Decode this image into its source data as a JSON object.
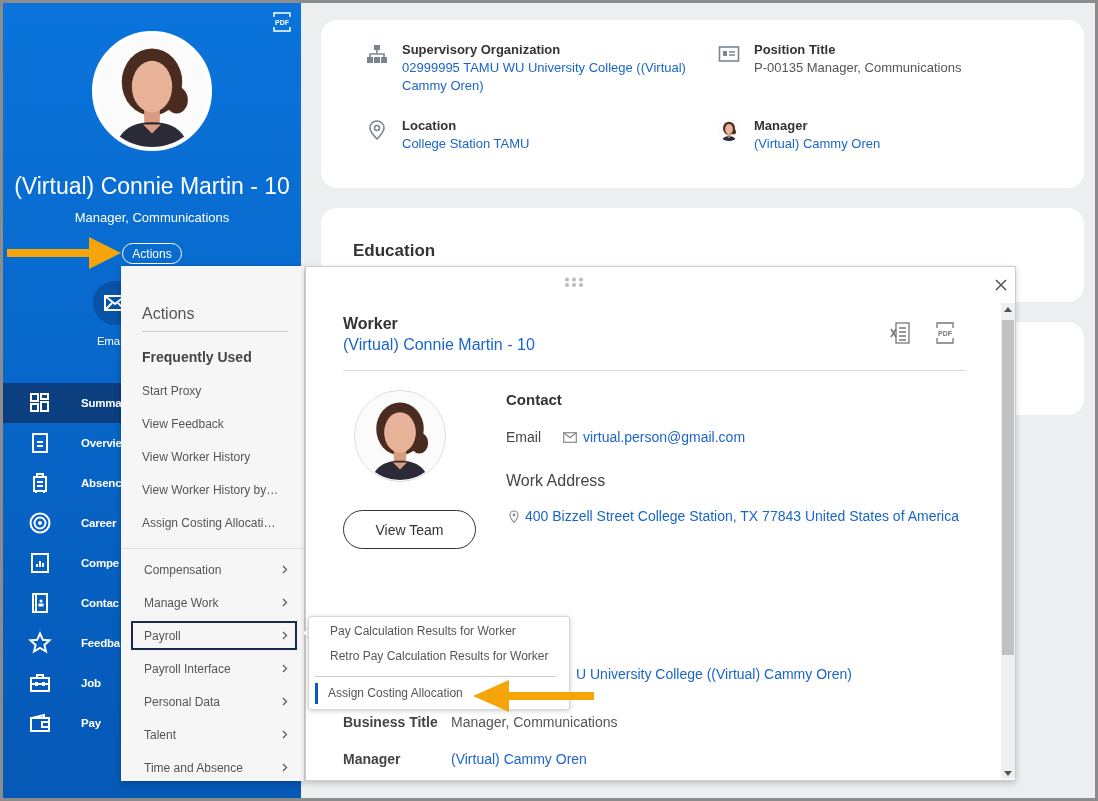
{
  "sidebar": {
    "pdf_label": "PDF",
    "name": "(Virtual) Connie Martin - 10",
    "title": "Manager, Communications",
    "actions_button": "Actions",
    "quick_actions": [
      {
        "label": "Ema"
      }
    ],
    "nav": [
      {
        "label": "Summa",
        "selected": true
      },
      {
        "label": "Overvie",
        "selected": false
      },
      {
        "label": "Absenc",
        "selected": false
      },
      {
        "label": "Career",
        "selected": false
      },
      {
        "label": "Compe",
        "selected": false
      },
      {
        "label": "Contac",
        "selected": false
      },
      {
        "label": "Feedba",
        "selected": false
      },
      {
        "label": "Job",
        "selected": false
      },
      {
        "label": "Pay",
        "selected": false
      }
    ]
  },
  "profile_card": {
    "fields": [
      {
        "label": "Supervisory Organization",
        "value": "02999995 TAMU WU University College ((Virtual) Cammy Oren)",
        "kind": "link"
      },
      {
        "label": "Position Title",
        "value": "P-00135 Manager, Communications",
        "kind": "text"
      },
      {
        "label": "Location",
        "value": "College Station TAMU",
        "kind": "link"
      },
      {
        "label": "Manager",
        "value": "(Virtual) Cammy Oren",
        "kind": "link"
      }
    ]
  },
  "education_card": {
    "title": "Education"
  },
  "actions_menu": {
    "title": "Actions",
    "frequently_used": {
      "title": "Frequently Used",
      "items": [
        "Start Proxy",
        "View Feedback",
        "View Worker History",
        "View Worker History by…",
        "Assign Costing Allocati…"
      ]
    },
    "categories": [
      {
        "label": "Compensation",
        "selected": false
      },
      {
        "label": "Manage Work",
        "selected": false
      },
      {
        "label": "Payroll",
        "selected": true
      },
      {
        "label": "Payroll Interface",
        "selected": false
      },
      {
        "label": "Personal Data",
        "selected": false
      },
      {
        "label": "Talent",
        "selected": false
      },
      {
        "label": "Time and Absence",
        "selected": false
      }
    ]
  },
  "worker_popup": {
    "pdf_label": "PDF",
    "title": "Worker",
    "worker": "(Virtual) Connie Martin - 10",
    "view_team_button": "View Team",
    "contact": {
      "title": "Contact",
      "email_label": "Email",
      "email": "virtual.person@gmail.com",
      "work_address_label": "Work Address",
      "address": "400 Bizzell Street College Station, TX 77843 United States of America"
    },
    "rows": [
      {
        "value": "U University College ((Virtual) Cammy Oren)",
        "kind": "link"
      },
      {
        "label": "Business Title",
        "value": "Manager, Communications",
        "kind": "text"
      },
      {
        "label": "Manager",
        "value": "(Virtual) Cammy Oren",
        "kind": "link"
      }
    ]
  },
  "payroll_submenu": {
    "groups": [
      [
        {
          "label": "Pay Calculation Results for Worker",
          "selected": false
        },
        {
          "label": "Retro Pay Calculation Results for Worker",
          "selected": false
        }
      ],
      [
        {
          "label": "Assign Costing Allocation",
          "selected": true
        }
      ]
    ]
  }
}
